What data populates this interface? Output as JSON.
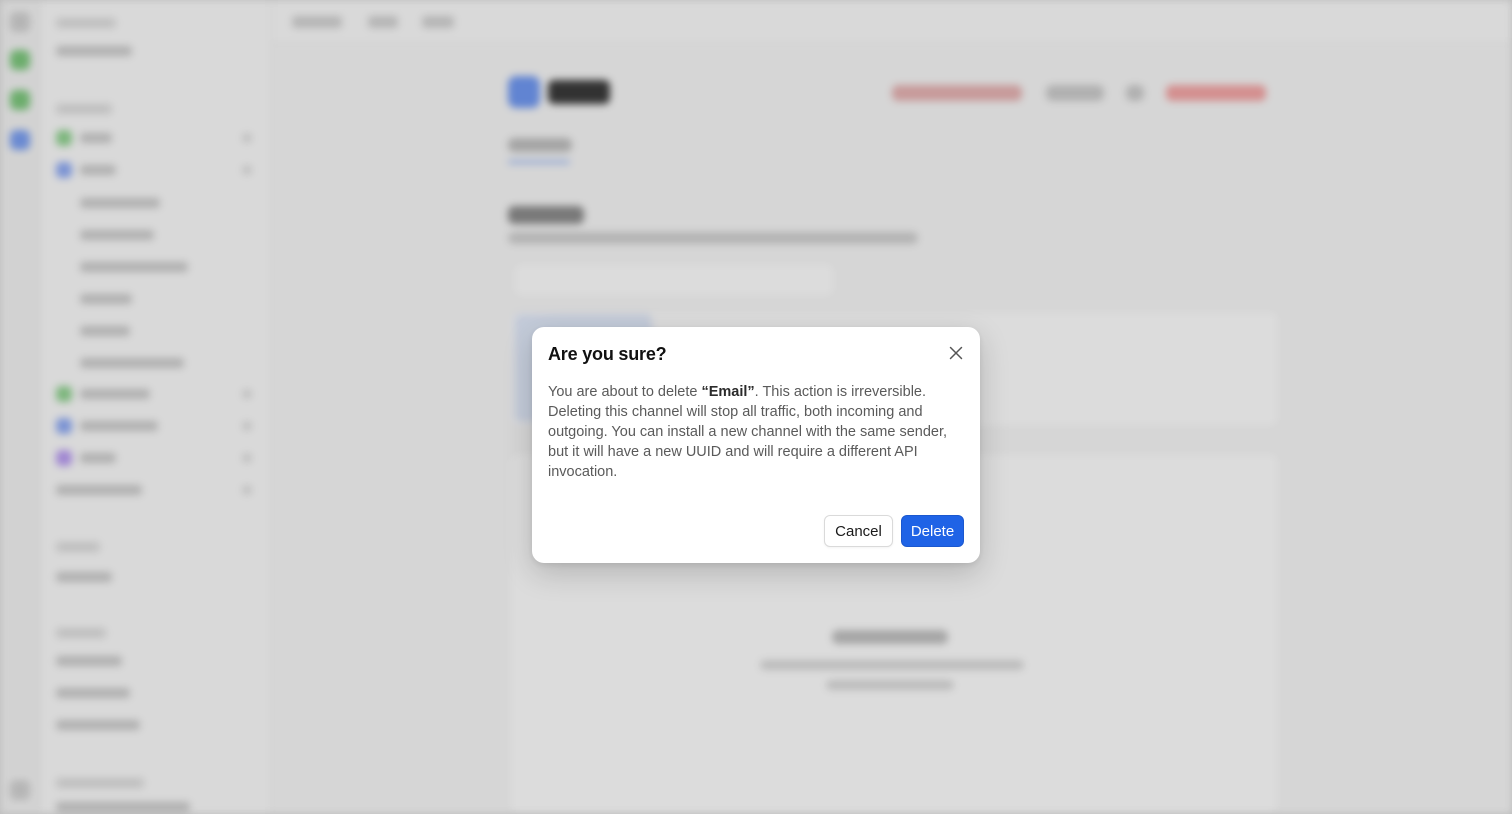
{
  "dialog": {
    "title": "Are you sure?",
    "body_prefix": "You are about to delete ",
    "body_item": "“Email”",
    "body_suffix": ". This action is irreversible. Deleting this channel will stop all traffic, both incoming and outgoing. You can install a new channel with the same sender, but it will have a new UUID and will require a different API invocation.",
    "cancel_label": "Cancel",
    "delete_label": "Delete",
    "close_icon": "close-icon"
  },
  "colors": {
    "primary": "#1f63e6",
    "overlay": "rgba(0,0,0,0.12)",
    "danger_text": "#ef4444"
  }
}
